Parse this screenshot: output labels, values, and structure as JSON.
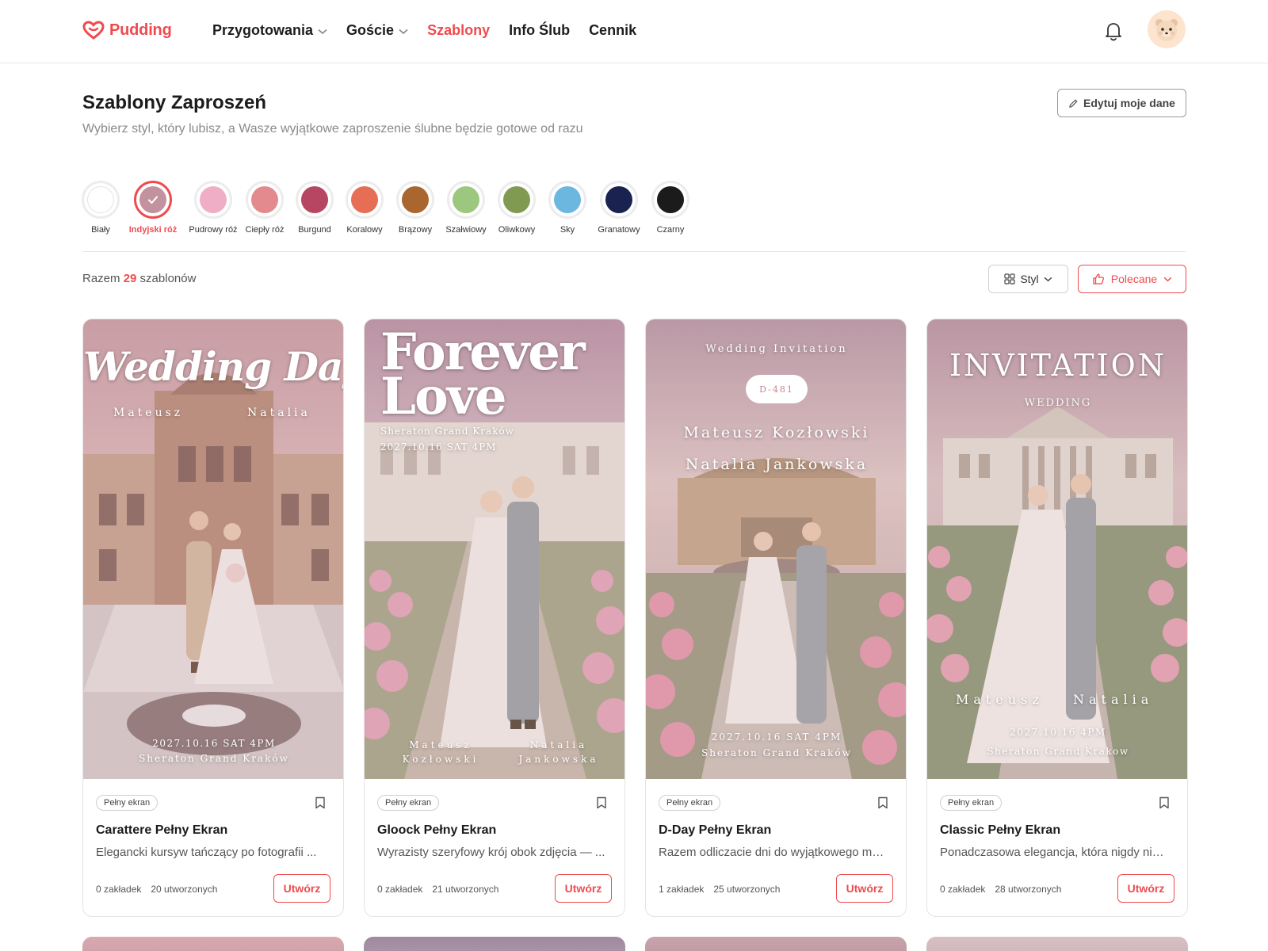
{
  "header": {
    "logo_text": "Pudding",
    "nav": [
      {
        "label": "Przygotowania",
        "has_dropdown": true,
        "active": false
      },
      {
        "label": "Goście",
        "has_dropdown": true,
        "active": false
      },
      {
        "label": "Szablony",
        "has_dropdown": false,
        "active": true
      },
      {
        "label": "Info Ślub",
        "has_dropdown": false,
        "active": false
      },
      {
        "label": "Cennik",
        "has_dropdown": false,
        "active": false
      }
    ]
  },
  "page": {
    "title": "Szablony Zaproszeń",
    "subtitle": "Wybierz styl, który lubisz, a Wasze wyjątkowe zaproszenie ślubne będzie gotowe od razu",
    "edit_button": "Edytuj moje dane"
  },
  "colors": [
    {
      "label": "Biały",
      "hex": "#ffffff",
      "selected": false
    },
    {
      "label": "Indyjski róż",
      "hex": "#c2939f",
      "selected": true
    },
    {
      "label": "Pudrowy róż",
      "hex": "#f0aec6",
      "selected": false
    },
    {
      "label": "Ciepły róż",
      "hex": "#e28a8e",
      "selected": false
    },
    {
      "label": "Burgund",
      "hex": "#b64661",
      "selected": false
    },
    {
      "label": "Koralowy",
      "hex": "#e66e54",
      "selected": false
    },
    {
      "label": "Brązowy",
      "hex": "#a9672f",
      "selected": false
    },
    {
      "label": "Szałwiowy",
      "hex": "#9cc77f",
      "selected": false
    },
    {
      "label": "Oliwkowy",
      "hex": "#819a52",
      "selected": false
    },
    {
      "label": "Sky",
      "hex": "#6cb7e0",
      "selected": false
    },
    {
      "label": "Granatowy",
      "hex": "#1a2350",
      "selected": false
    },
    {
      "label": "Czarny",
      "hex": "#1b1b1b",
      "selected": false
    }
  ],
  "toolbar": {
    "count_prefix": "Razem",
    "count": "29",
    "count_suffix": "szablonów",
    "style_label": "Styl",
    "sort_label": "Polecane"
  },
  "cards": [
    {
      "badge": "Pełny ekran",
      "title": "Carattere Pełny Ekran",
      "desc": "Elegancki kursyw tańczący po fotografii ...",
      "bookmarks": "0 zakładek",
      "created": "20 utworzonych",
      "button": "Utwórz",
      "thumb": {
        "headline": "Wedding Day",
        "names_left": "Mateusz",
        "names_right": "Natalia",
        "date": "2027.10.16 SAT 4PM",
        "venue": "Sheraton Grand Kraków"
      }
    },
    {
      "badge": "Pełny ekran",
      "title": "Gloock Pełny Ekran",
      "desc": "Wyrazisty szeryfowy krój obok zdjęcia — ...",
      "bookmarks": "0 zakładek",
      "created": "21 utworzonych",
      "button": "Utwórz",
      "thumb": {
        "headline_1": "Forever",
        "headline_2": "Love",
        "venue": "Sheraton Grand Kraków",
        "date": "2027.10.16 SAT 4PM",
        "groom_first": "Mateusz",
        "groom_last": "Kozłowski",
        "bride_first": "Natalia",
        "bride_last": "Jankowska"
      }
    },
    {
      "badge": "Pełny ekran",
      "title": "D-Day Pełny Ekran",
      "desc": "Razem odliczacie dni do wyjątkowego mo...",
      "bookmarks": "1 zakładek",
      "created": "25 utworzonych",
      "button": "Utwórz",
      "thumb": {
        "top": "Wedding Invitation",
        "dday": "D-481",
        "groom": "Mateusz Kozłowski",
        "bride": "Natalia Jankowska",
        "date": "2027.10.16 SAT 4PM",
        "venue": "Sheraton Grand Kraków"
      }
    },
    {
      "badge": "Pełny ekran",
      "title": "Classic Pełny Ekran",
      "desc": "Ponadczasowa elegancja, która nigdy nie ...",
      "bookmarks": "0 zakładek",
      "created": "28 utworzonych",
      "button": "Utwórz",
      "thumb": {
        "headline": "INVITATION",
        "sub": "WEDDING",
        "names_left": "Mateusz",
        "names_right": "Natalia",
        "date": "2027.10.16 4PM",
        "venue": "Sheraton Grand Krakow"
      }
    }
  ]
}
